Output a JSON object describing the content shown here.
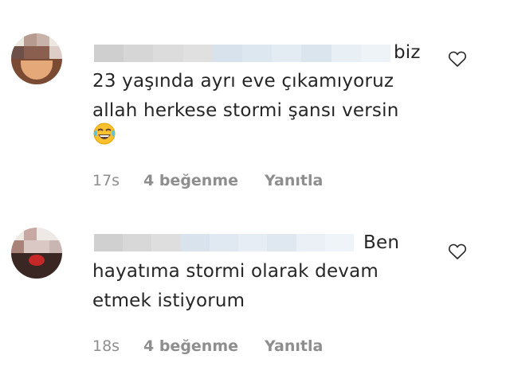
{
  "comments": [
    {
      "time": "17s",
      "likes": "4 beğenme",
      "reply": "Yanıtla",
      "text_first": "biz",
      "lines": [
        "23 yaşında ayrı eve çıkamıyoruz",
        "allah herkese stormi şansı versin"
      ],
      "emoji": "laughing-tears-emoji"
    },
    {
      "time": "18s",
      "likes": "4 beğenme",
      "reply": "Yanıtla",
      "text_first": "Ben",
      "lines": [
        "hayatıma stormi olarak devam",
        "etmek istiyorum"
      ]
    }
  ],
  "colors": {
    "text": "#262626",
    "meta": "#8e8e8e",
    "blur_gray": "#d9d9d9",
    "blur_blue": "#d6e3ef"
  }
}
